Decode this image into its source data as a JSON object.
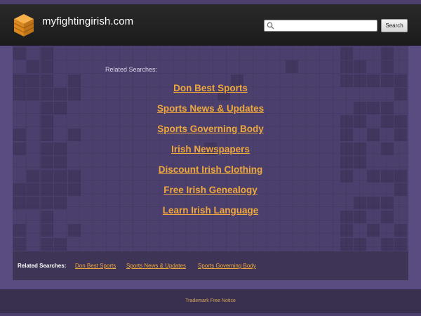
{
  "colors": {
    "accent_link": "#f0a83c",
    "page_background": "#5a4c80",
    "header_background": "#1f1f1f",
    "content_background": "#4a3f6d"
  },
  "header": {
    "site_name": "myfightingirish.com",
    "logo_icon": "stacked-cube-logo-icon",
    "search": {
      "placeholder": "",
      "value": "",
      "icon": "search-icon",
      "button_label": "Search"
    }
  },
  "main": {
    "related_label": "Related Searches:",
    "links": [
      "Don Best Sports",
      "Sports News & Updates",
      "Sports Governing Body",
      "Irish Newspapers",
      "Discount Irish Clothing",
      "Free Irish Genealogy",
      "Learn Irish Language"
    ]
  },
  "bottom_bar": {
    "label": "Related Searches:",
    "links": [
      "Don Best Sports",
      "Sports News & Updates",
      "Sports Governing Body"
    ]
  },
  "footer": {
    "text": "Trademark Free Notice"
  }
}
